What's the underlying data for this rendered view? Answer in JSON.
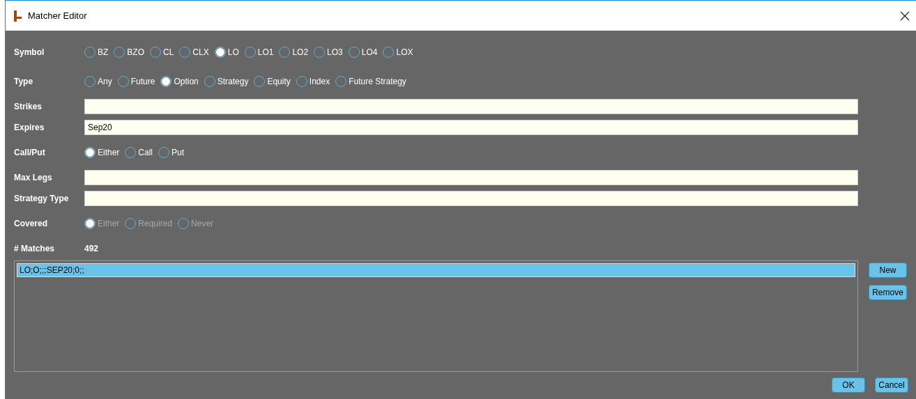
{
  "window": {
    "title": "Matcher Editor"
  },
  "rows": [
    {
      "kind": "radio",
      "label": "Symbol",
      "disabled": false,
      "options": [
        {
          "label": "BZ",
          "selected": false
        },
        {
          "label": "BZO",
          "selected": false
        },
        {
          "label": "CL",
          "selected": false
        },
        {
          "label": "CLX",
          "selected": false
        },
        {
          "label": "LO",
          "selected": true
        },
        {
          "label": "LO1",
          "selected": false
        },
        {
          "label": "LO2",
          "selected": false
        },
        {
          "label": "LO3",
          "selected": false
        },
        {
          "label": "LO4",
          "selected": false
        },
        {
          "label": "LOX",
          "selected": false
        }
      ]
    },
    {
      "kind": "radio",
      "label": "Type",
      "disabled": false,
      "options": [
        {
          "label": "Any",
          "selected": false
        },
        {
          "label": "Future",
          "selected": false
        },
        {
          "label": "Option",
          "selected": true
        },
        {
          "label": "Strategy",
          "selected": false
        },
        {
          "label": "Equity",
          "selected": false
        },
        {
          "label": "Index",
          "selected": false
        },
        {
          "label": "Future Strategy",
          "selected": false
        }
      ]
    },
    {
      "kind": "text",
      "label": "Strikes"
    },
    {
      "kind": "text",
      "label": "Expires",
      "value": "Sep20"
    },
    {
      "kind": "radio",
      "label": "Call/Put",
      "disabled": false,
      "options": [
        {
          "label": "Either",
          "selected": true
        },
        {
          "label": "Call",
          "selected": false
        },
        {
          "label": "Put",
          "selected": false
        }
      ]
    },
    {
      "kind": "text",
      "label": "Max Legs"
    },
    {
      "kind": "text",
      "label": "Strategy Type"
    },
    {
      "kind": "radio",
      "label": "Covered",
      "disabled": true,
      "options": [
        {
          "label": "Either",
          "selected": true
        },
        {
          "label": "Required",
          "selected": false
        },
        {
          "label": "Never",
          "selected": false
        }
      ]
    },
    {
      "kind": "value",
      "label": "# Matches",
      "value": "492"
    }
  ],
  "matchers": [
    {
      "text": "LO;O;;;SEP20;0;;",
      "selected": true
    }
  ],
  "side_buttons": [
    "New",
    "Remove"
  ],
  "buttons": [
    "OK",
    "Cancel"
  ]
}
